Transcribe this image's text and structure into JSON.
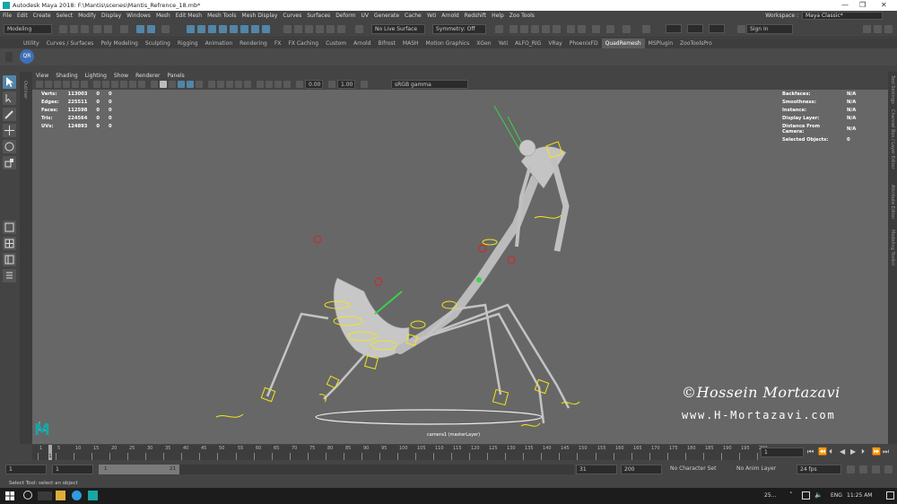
{
  "window": {
    "title": "Autodesk Maya 2018: F:\\Mantis\\scenes\\Mantis_Refrence_18.mb*",
    "controls": [
      "—",
      "❐",
      "✕"
    ]
  },
  "menu": {
    "items": [
      "File",
      "Edit",
      "Create",
      "Select",
      "Modify",
      "Display",
      "Windows",
      "Mesh",
      "Edit Mesh",
      "Mesh Tools",
      "Mesh Display",
      "Curves",
      "Surfaces",
      "Deform",
      "UV",
      "Generate",
      "Cache",
      "Yeti",
      "Arnold",
      "Redshift",
      "Help",
      "Zoo Tools"
    ],
    "workspace_label": "Workspace :",
    "workspace_value": "Maya Classic*"
  },
  "status_line": {
    "menuset": "Modeling",
    "live_surface": "No Live Surface",
    "symmetry": "Symmetry: Off",
    "signin": "Sign In"
  },
  "shelf": {
    "tabs": [
      "Utility",
      "Curves / Surfaces",
      "Poly Modeling",
      "Sculpting",
      "Rigging",
      "Animation",
      "Rendering",
      "FX",
      "FX Caching",
      "Custom",
      "Arnold",
      "Bifrost",
      "MASH",
      "Motion Graphics",
      "XGen",
      "Yeti",
      "ALFO_RIG",
      "VRay",
      "PhoenixFD",
      "QuadRemesh",
      "MSPlugin",
      "ZooToolsPro"
    ],
    "active_tab": "QuadRemesh",
    "qr_label": "QR"
  },
  "viewport": {
    "menus": [
      "View",
      "Shading",
      "Lighting",
      "Show",
      "Renderer",
      "Panels"
    ],
    "exposure": "0.00",
    "gamma": "1.00",
    "color_space": "sRGB gamma",
    "camera_label": "camera1 (masterLayer)",
    "left_label": "Outliner",
    "right_labels": [
      "Modeling Toolkit",
      "Attribute Editor",
      "Channel Box / Layer Editor",
      "Tool Settings"
    ],
    "hud_left": [
      {
        "label": "Verts:",
        "v1": "113003",
        "v2": "0",
        "v3": "0"
      },
      {
        "label": "Edges:",
        "v1": "225511",
        "v2": "0",
        "v3": "0"
      },
      {
        "label": "Faces:",
        "v1": "112598",
        "v2": "0",
        "v3": "0"
      },
      {
        "label": "Tris:",
        "v1": "224564",
        "v2": "0",
        "v3": "0"
      },
      {
        "label": "UVs:",
        "v1": "124893",
        "v2": "0",
        "v3": "0"
      }
    ],
    "hud_right": [
      {
        "label": "Backfaces:",
        "value": "N/A"
      },
      {
        "label": "Smoothness:",
        "value": "N/A"
      },
      {
        "label": "Instance:",
        "value": "N/A"
      },
      {
        "label": "Display Layer:",
        "value": "N/A"
      },
      {
        "label": "Distance From Camera:",
        "value": "N/A"
      },
      {
        "label": "Selected Objects:",
        "value": "0"
      }
    ],
    "watermark_line1": "©Hossein Mortazavi",
    "watermark_line2": "www.H-Mortazavi.com"
  },
  "timeline": {
    "ticks": [
      "1",
      "5",
      "10",
      "15",
      "20",
      "25",
      "30",
      "35",
      "40",
      "45",
      "50",
      "55",
      "60",
      "65",
      "70",
      "75",
      "80",
      "85",
      "90",
      "95",
      "100",
      "105",
      "110",
      "115",
      "120",
      "125",
      "130",
      "135",
      "140",
      "145",
      "150",
      "155",
      "160",
      "165",
      "170",
      "175",
      "180",
      "185",
      "190",
      "195",
      "200"
    ],
    "current_frame_marker": "1",
    "current_frame": "1",
    "range_start": "1",
    "playback_start": "1",
    "range_slider_start": "1",
    "range_slider_end": "21",
    "range_end": "31",
    "playback_end": "200",
    "character_set": "No Character Set",
    "anim_layer": "No Anim Layer",
    "fps": "24 fps"
  },
  "help_line": "Select Tool: select an object",
  "taskbar": {
    "temp": "25...",
    "lang": "ENG",
    "time": "11:25 AM"
  }
}
